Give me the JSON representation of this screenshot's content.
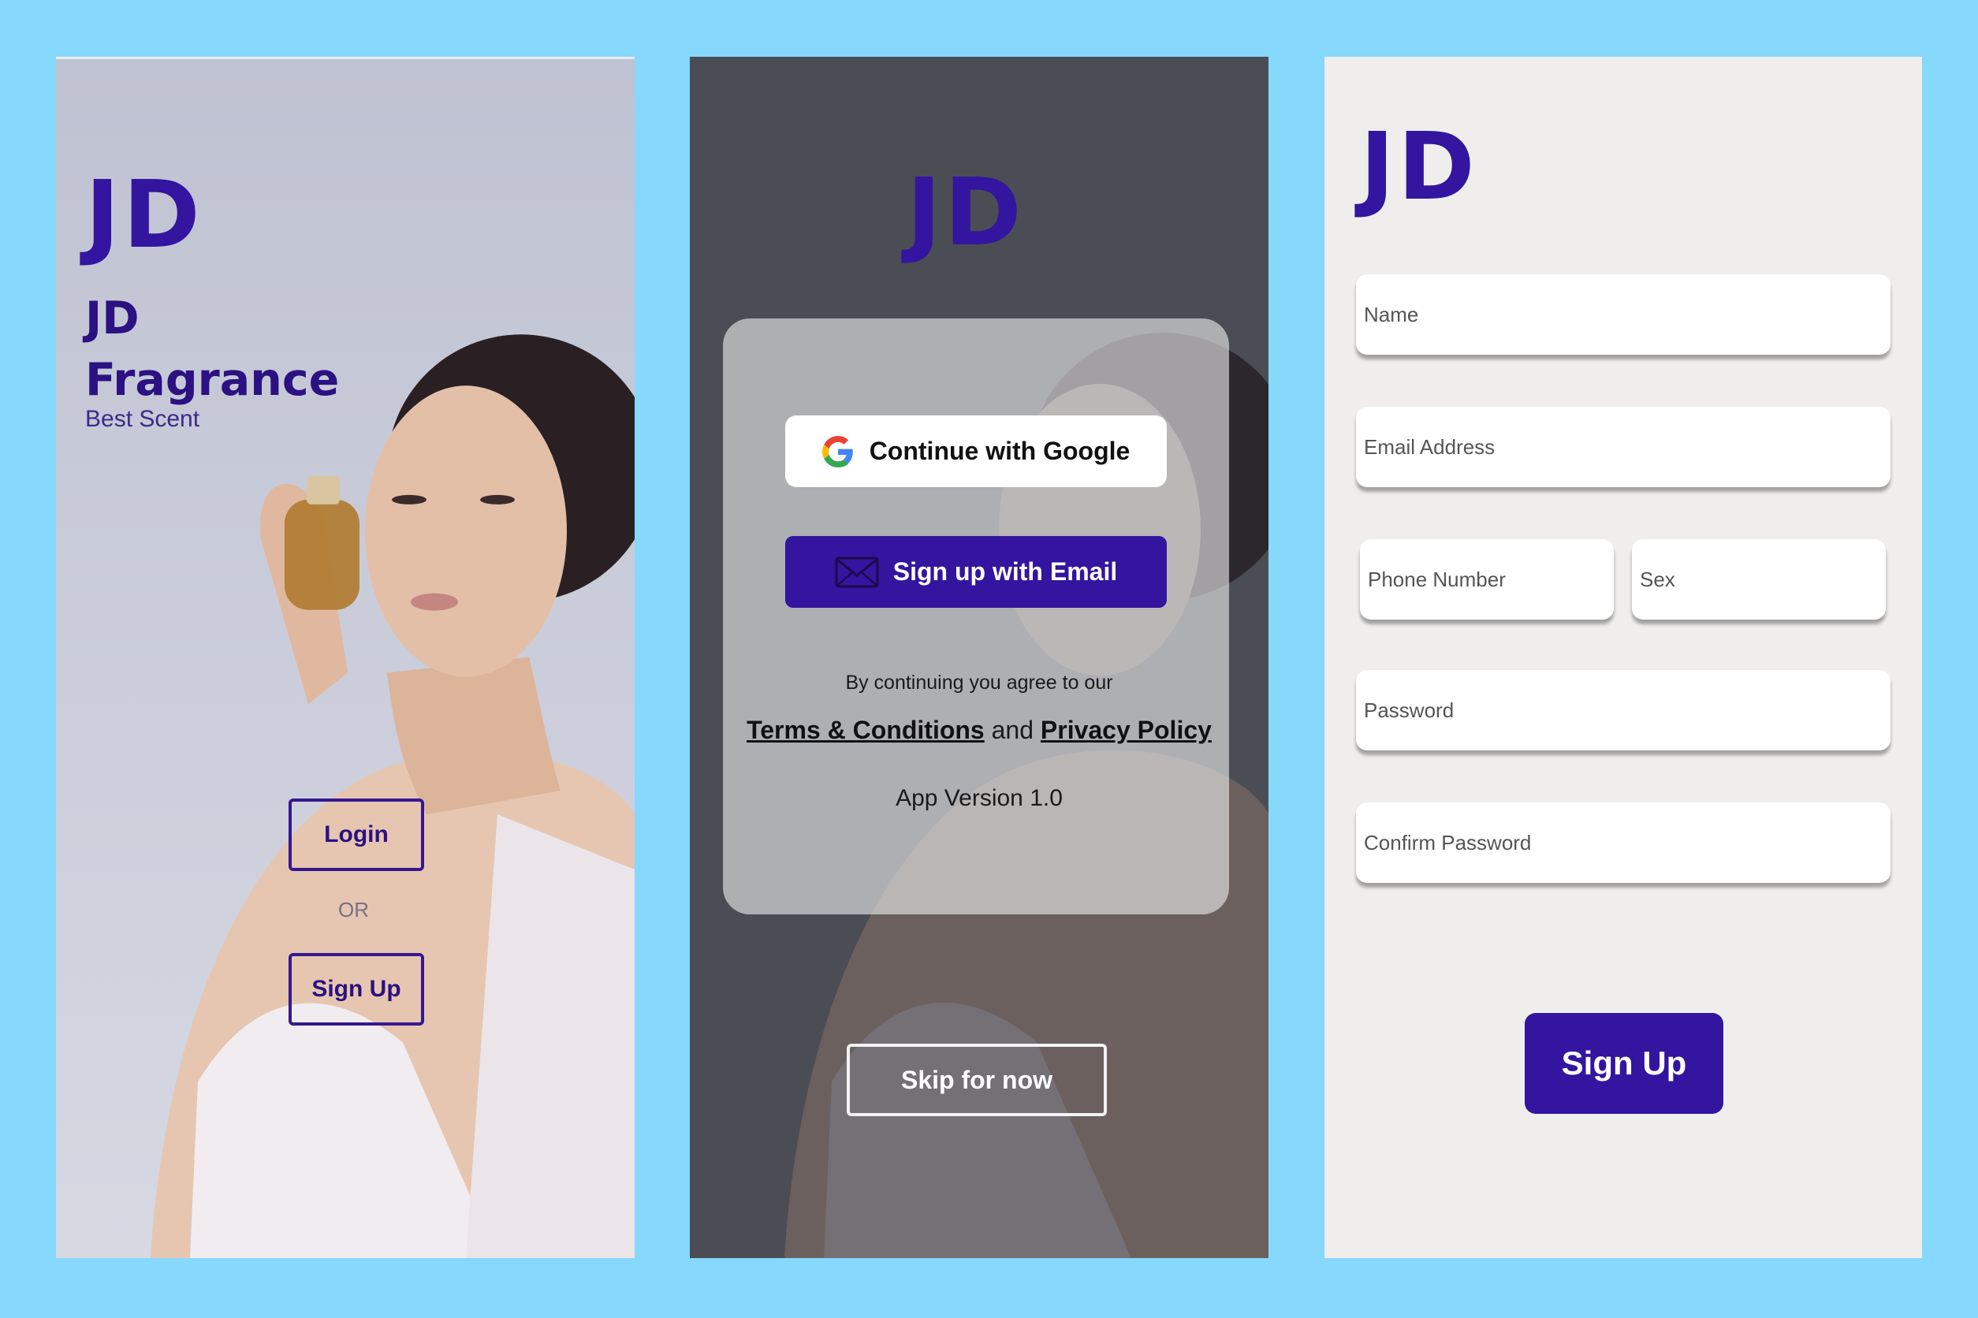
{
  "colors": {
    "page_bg": "#86d8fd",
    "brand": "#33159f"
  },
  "screen1": {
    "logo": "JD",
    "title_line1": "JD",
    "title_line2": "Fragrance",
    "subtitle": "Best Scent",
    "login_label": "Login",
    "or_label": "OR",
    "signup_label": "Sign Up"
  },
  "screen2": {
    "logo": "JD",
    "google_label": "Continue with Google",
    "google_icon": "google-g-icon",
    "email_label": "Sign up with Email",
    "email_icon": "envelope-icon",
    "agree_text": "By continuing you agree to our",
    "terms_label": "Terms & Conditions",
    "and_text": "and",
    "privacy_label": "Privacy Policy",
    "version_text": "App Version 1.0",
    "skip_label": "Skip for now"
  },
  "screen3": {
    "logo": "JD",
    "name_placeholder": "Name",
    "email_placeholder": "Email Address",
    "phone_placeholder": "Phone Number",
    "sex_placeholder": "Sex",
    "password_placeholder": "Password",
    "confirm_placeholder": "Confirm Password",
    "submit_label": "Sign Up"
  }
}
